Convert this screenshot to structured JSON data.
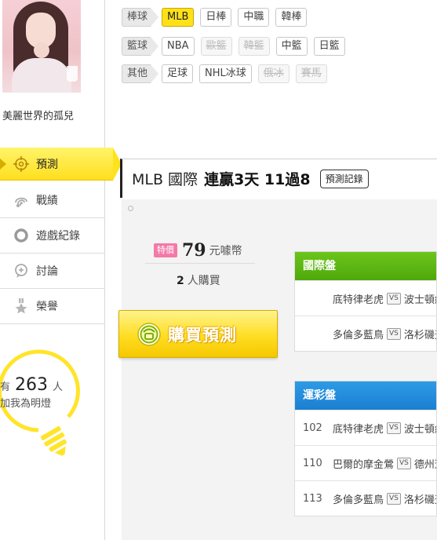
{
  "profile": {
    "nickname": "美麗世界的孤兒"
  },
  "menu": {
    "items": [
      {
        "label": "預測",
        "icon": "target-icon",
        "active": true
      },
      {
        "label": "戰績",
        "icon": "fingerprint-icon",
        "active": false
      },
      {
        "label": "遊戲紀錄",
        "icon": "ring-icon",
        "active": false
      },
      {
        "label": "討論",
        "icon": "discussion-icon",
        "active": false
      },
      {
        "label": "榮譽",
        "icon": "medal-icon",
        "active": false
      }
    ]
  },
  "fans": {
    "prefix": "有",
    "count": "263",
    "unit": "人",
    "caption": "加我為明燈"
  },
  "filters": {
    "rows": [
      {
        "category": "棒球",
        "tags": [
          {
            "label": "MLB",
            "state": "selected"
          },
          {
            "label": "日棒",
            "state": "normal"
          },
          {
            "label": "中職",
            "state": "normal"
          },
          {
            "label": "韓棒",
            "state": "normal"
          }
        ]
      },
      {
        "category": "籃球",
        "tags": [
          {
            "label": "NBA",
            "state": "normal"
          },
          {
            "label": "歐籃",
            "state": "disabled"
          },
          {
            "label": "韓籃",
            "state": "disabled"
          },
          {
            "label": "中籃",
            "state": "normal"
          },
          {
            "label": "日籃",
            "state": "normal"
          }
        ]
      },
      {
        "category": "其他",
        "tags": [
          {
            "label": "足球",
            "state": "normal"
          },
          {
            "label": "NHL冰球",
            "state": "normal"
          },
          {
            "label": "俄冰",
            "state": "disabled"
          },
          {
            "label": "賽馬",
            "state": "disabled"
          }
        ]
      }
    ]
  },
  "header": {
    "league": "MLB 國際",
    "streak": "連贏3天 11過8",
    "record_button": "預測記錄"
  },
  "purchase": {
    "badge": "特價",
    "price": "79",
    "currency": "元噱幣",
    "buyers_count": "2",
    "buyers_label": "人購買",
    "button_label": "購買預測",
    "button_icon": "coin-icon"
  },
  "tables": [
    {
      "title": "國際盤",
      "color": "#5cb814",
      "rows": [
        {
          "no": "",
          "home": "底特律老虎",
          "vs": "VS",
          "away": "波士頓紅襪"
        },
        {
          "no": "",
          "home": "多倫多藍鳥",
          "vs": "VS",
          "away": "洛杉磯天使"
        }
      ]
    },
    {
      "title": "運彩盤",
      "color": "#1f88dc",
      "rows": [
        {
          "no": "102",
          "home": "底特律老虎",
          "vs": "VS",
          "away": "波士頓紅襪"
        },
        {
          "no": "110",
          "home": "巴爾的摩金鶯",
          "vs": "VS",
          "away": "德州遊騎兵"
        },
        {
          "no": "113",
          "home": "多倫多藍鳥",
          "vs": "VS",
          "away": "洛杉磯天使"
        }
      ]
    }
  ],
  "colors": {
    "accent_yellow": "#ffdf1d",
    "international_green": "#5cb814",
    "lottery_blue": "#1f88dc",
    "special_pink": "#f37aa8"
  }
}
